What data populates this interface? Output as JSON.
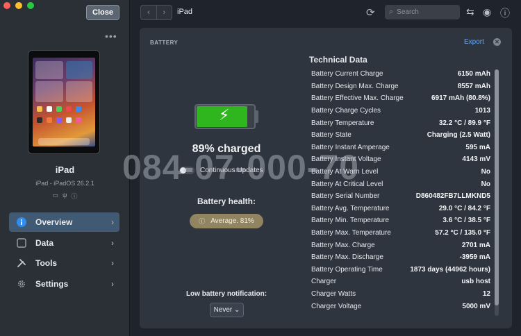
{
  "window": {
    "close_label": "Close",
    "more_label": "•••"
  },
  "device": {
    "name": "iPad",
    "os": "iPad - iPadOS 26.2.1"
  },
  "status_icons": [
    "battery-icon",
    "usb-icon",
    "info-icon"
  ],
  "nav": [
    {
      "label": "Overview",
      "icon": "info-icon",
      "active": true
    },
    {
      "label": "Data",
      "icon": "square-icon",
      "active": false
    },
    {
      "label": "Tools",
      "icon": "tools-icon",
      "active": false
    },
    {
      "label": "Settings",
      "icon": "gear-icon",
      "active": false
    }
  ],
  "topbar": {
    "title": "iPad",
    "search_placeholder": "Search"
  },
  "battery": {
    "section_title": "BATTERY",
    "export_label": "Export",
    "charge_fraction": 0.89,
    "charged_text": "89% charged",
    "continuous_updates": "Continuous Updates",
    "health_label": "Battery health:",
    "health_value": "Average. 81%",
    "low_notification_label": "Low battery notification:",
    "low_notification_value": "Never ⌄",
    "accent_color": "#2fb61f",
    "health_color": "#918461"
  },
  "watermark": "084-07-000-70",
  "technical": {
    "title": "Technical Data",
    "rows": [
      {
        "k": "Battery Current Charge",
        "v": "6150 mAh"
      },
      {
        "k": "Battery Design Max. Charge",
        "v": "8557 mAh"
      },
      {
        "k": "Battery Effective Max. Charge",
        "v": "6917 mAh (80.8%)"
      },
      {
        "k": "Battery Charge Cycles",
        "v": "1013"
      },
      {
        "k": "Battery Temperature",
        "v": "32.2 °C / 89.9 °F"
      },
      {
        "k": "Battery State",
        "v": "Charging (2.5 Watt)"
      },
      {
        "k": "Battery Instant Amperage",
        "v": "595 mA"
      },
      {
        "k": "Battery Instant Voltage",
        "v": "4143 mV"
      },
      {
        "k": "Battery At Warn Level",
        "v": "No"
      },
      {
        "k": "Battery At Critical Level",
        "v": "No"
      },
      {
        "k": "Battery Serial Number",
        "v": "D860482FB7LLMKND5"
      },
      {
        "k": "Battery Avg. Temperature",
        "v": "29.0 °C / 84.2 °F"
      },
      {
        "k": "Battery Min. Temperature",
        "v": "3.6 °C / 38.5 °F"
      },
      {
        "k": "Battery Max. Temperature",
        "v": "57.2 °C / 135.0 °F"
      },
      {
        "k": "Battery Max. Charge",
        "v": "2701 mA"
      },
      {
        "k": "Battery Max. Discharge",
        "v": "-3959 mA"
      },
      {
        "k": "Battery Operating Time",
        "v": "1873 days (44962 hours)"
      },
      {
        "k": "Charger",
        "v": "usb host"
      },
      {
        "k": "Charger Watts",
        "v": "12"
      },
      {
        "k": "Charger Voltage",
        "v": "5000 mV"
      }
    ]
  }
}
